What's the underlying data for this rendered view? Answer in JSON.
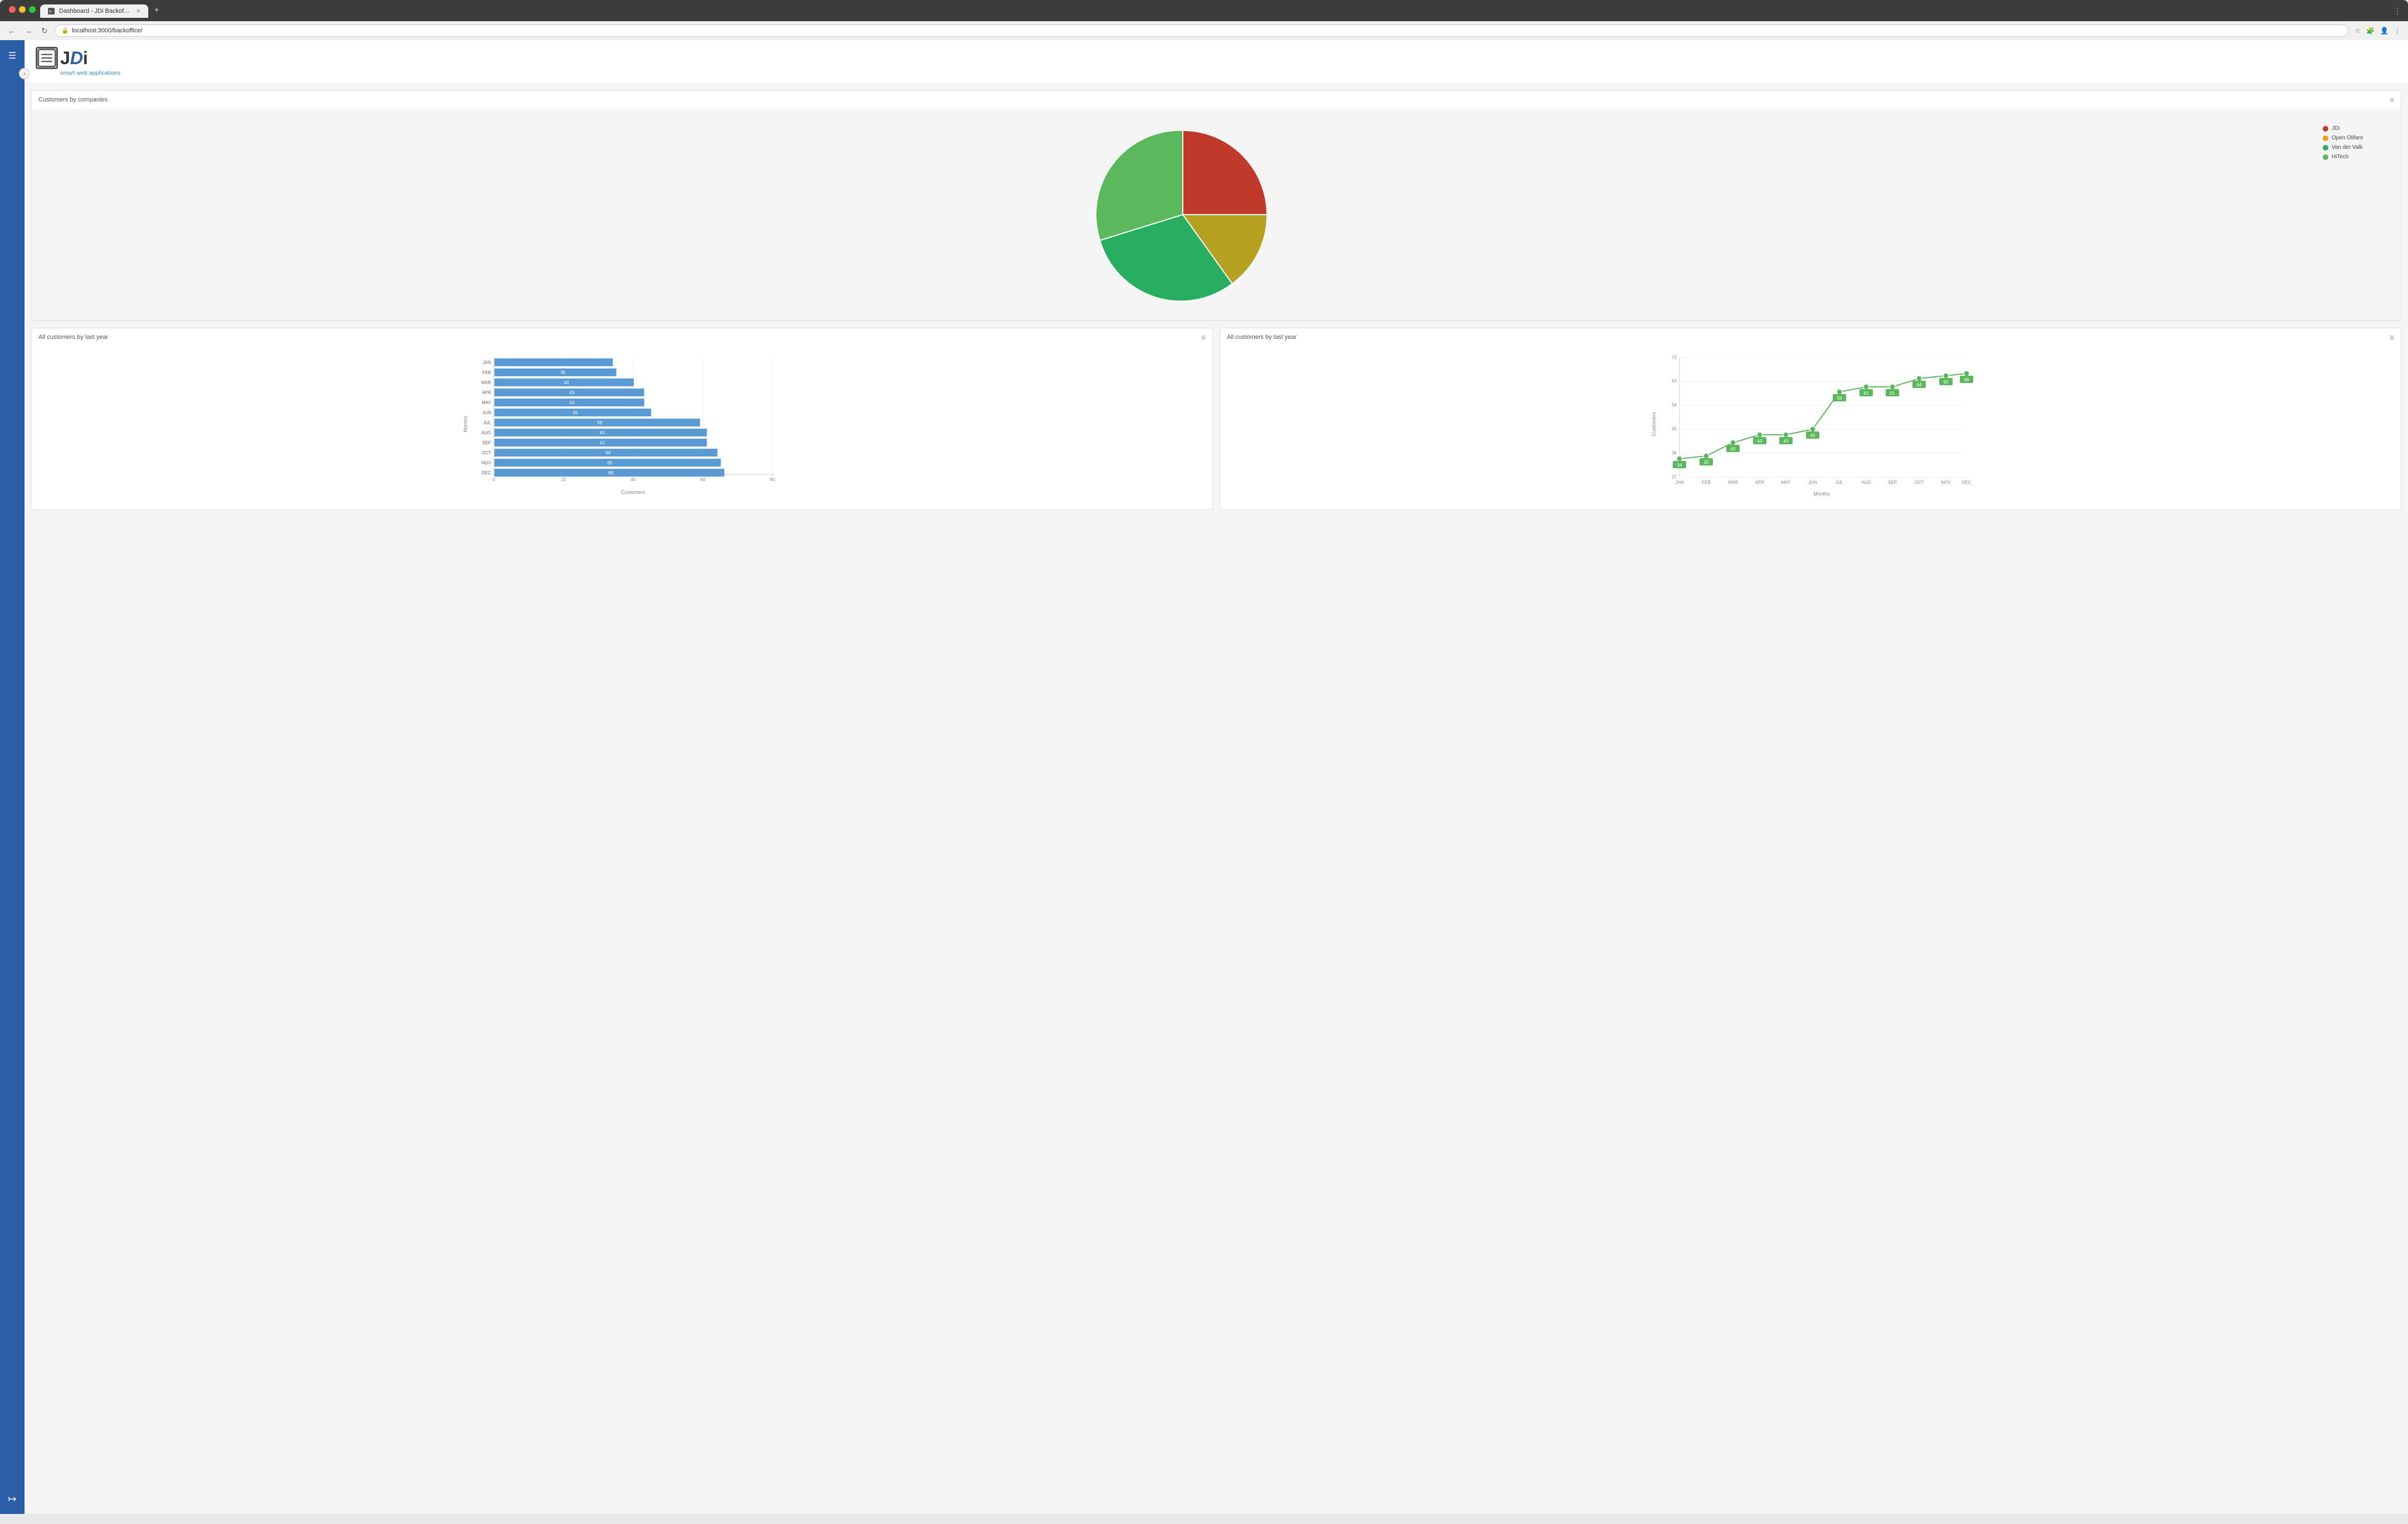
{
  "browser": {
    "tab_title": "Dashboard - JDi Backoffice",
    "url": "localhost:3000/backoffice/",
    "new_tab_label": "+"
  },
  "logo": {
    "icon_char": "≡",
    "text_j": "J",
    "text_d": "D",
    "text_i": "i",
    "tagline": "smart web applications"
  },
  "pie_chart": {
    "title": "Customers by companies",
    "menu_icon": "≡",
    "legend": [
      {
        "label": "JDi",
        "color": "#c0392b"
      },
      {
        "label": "Open Olifant",
        "color": "#f39c12"
      },
      {
        "label": "Van der Valk",
        "color": "#27ae60"
      },
      {
        "label": "HiTech",
        "color": "#2ecc71"
      }
    ],
    "segments": [
      {
        "label": "JDi",
        "value": 25,
        "color": "#c0392b",
        "startAngle": 0,
        "endAngle": 90
      },
      {
        "label": "Open Olifant",
        "value": 15,
        "color": "#b5a020",
        "startAngle": 90,
        "endAngle": 150
      },
      {
        "label": "Van der Valk",
        "value": 30,
        "color": "#27ae60",
        "startAngle": 150,
        "endAngle": 258
      },
      {
        "label": "HiTech",
        "value": 30,
        "color": "#5cb85c",
        "startAngle": 258,
        "endAngle": 360
      }
    ]
  },
  "bar_chart": {
    "title": "All customers by last year",
    "menu_icon": "≡",
    "x_label": "Customers",
    "y_label": "Months",
    "x_max": 80,
    "x_ticks": [
      0,
      20,
      40,
      60,
      80
    ],
    "bars": [
      {
        "month": "JAN",
        "value": 34
      },
      {
        "month": "FEB",
        "value": 35
      },
      {
        "month": "MAR",
        "value": 40
      },
      {
        "month": "APR",
        "value": 43
      },
      {
        "month": "MAY",
        "value": 43
      },
      {
        "month": "JUN",
        "value": 45
      },
      {
        "month": "JUL",
        "value": 59
      },
      {
        "month": "AUG",
        "value": 61
      },
      {
        "month": "SEP",
        "value": 61
      },
      {
        "month": "OCT",
        "value": 64
      },
      {
        "month": "NOV",
        "value": 65
      },
      {
        "month": "DEC",
        "value": 66
      }
    ],
    "bar_color": "#5b9bd5"
  },
  "line_chart": {
    "title": "All customers by last year",
    "menu_icon": "≡",
    "x_label": "Months",
    "y_label": "Customers",
    "y_min": 27,
    "y_max": 72,
    "y_ticks": [
      27,
      36,
      45,
      54,
      63,
      72
    ],
    "months": [
      "JAN",
      "FEB",
      "MAR",
      "APR",
      "MAY",
      "JUN",
      "JUL",
      "AUG",
      "SEP",
      "OCT",
      "NOV",
      "DEC"
    ],
    "points": [
      {
        "month": "JAN",
        "value": 34
      },
      {
        "month": "FEB",
        "value": 35
      },
      {
        "month": "MAR",
        "value": 40
      },
      {
        "month": "APR",
        "value": 43
      },
      {
        "month": "MAY",
        "value": 43
      },
      {
        "month": "JUN",
        "value": 45
      },
      {
        "month": "JUL",
        "value": 59
      },
      {
        "month": "AUG",
        "value": 61
      },
      {
        "month": "SEP",
        "value": 61
      },
      {
        "month": "OCT",
        "value": 64
      },
      {
        "month": "NOV",
        "value": 65
      },
      {
        "month": "DEC",
        "value": 66
      }
    ],
    "line_color": "#5cb85c"
  },
  "sidebar": {
    "toggle_icon": "☰",
    "expand_icon": "›",
    "logout_icon": "→"
  }
}
